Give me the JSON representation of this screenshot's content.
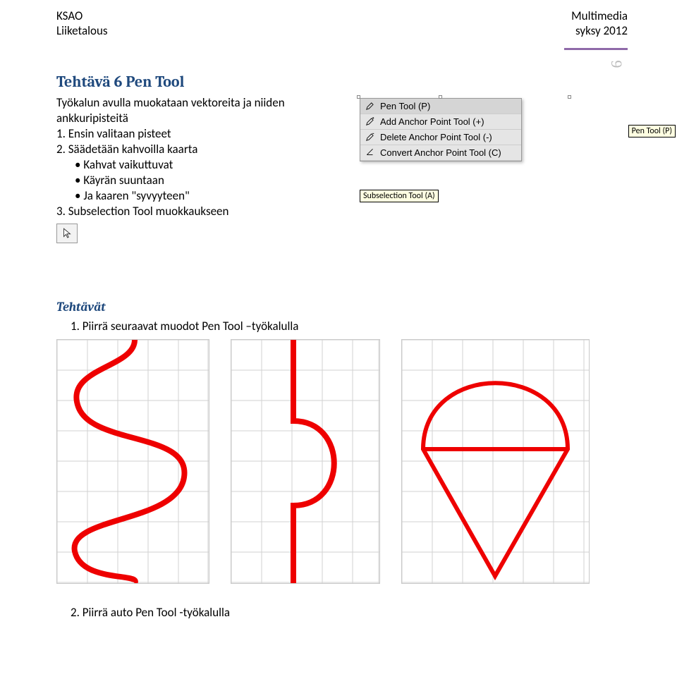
{
  "header": {
    "left1": "KSAO",
    "left2": "Liiketalous",
    "right1": "Multimedia",
    "right2": "syksy 2012"
  },
  "page_number": "6",
  "title": "Tehtävä 6 Pen Tool",
  "intro": "Työkalun avulla muokataan vektoreita ja niiden ankkuripisteitä",
  "step1": "1. Ensin valitaan pisteet",
  "step2": "2. Säädetään kahvoilla kaarta",
  "bullet1": "Kahvat vaikuttuvat",
  "bullet2": "Käyrän suuntaan",
  "bullet3": "Ja kaaren \"syvyyteen\"",
  "step3": "3. Subselection Tool muokkaukseen",
  "pen_menu": {
    "item1": "Pen Tool (P)",
    "item2": "Add Anchor Point Tool (+)",
    "item3": "Delete Anchor Point Tool (-)",
    "item4": "Convert Anchor Point Tool (C)"
  },
  "tooltip_pen": "Pen Tool (P)",
  "subselection_label": "Subselection Tool (A)",
  "tehtavat_heading": "Tehtävät",
  "task1": "1.  Piirrä seuraavat muodot Pen Tool –työkalulla",
  "task2": "2.   Piirrä auto Pen Tool -työkalulla",
  "colors": {
    "heading": "#1f497d",
    "accent_rule": "#8f6aa9",
    "shape_stroke": "#ee0000",
    "grid": "#d2d2d2",
    "tooltip_bg": "#ffffe1"
  }
}
